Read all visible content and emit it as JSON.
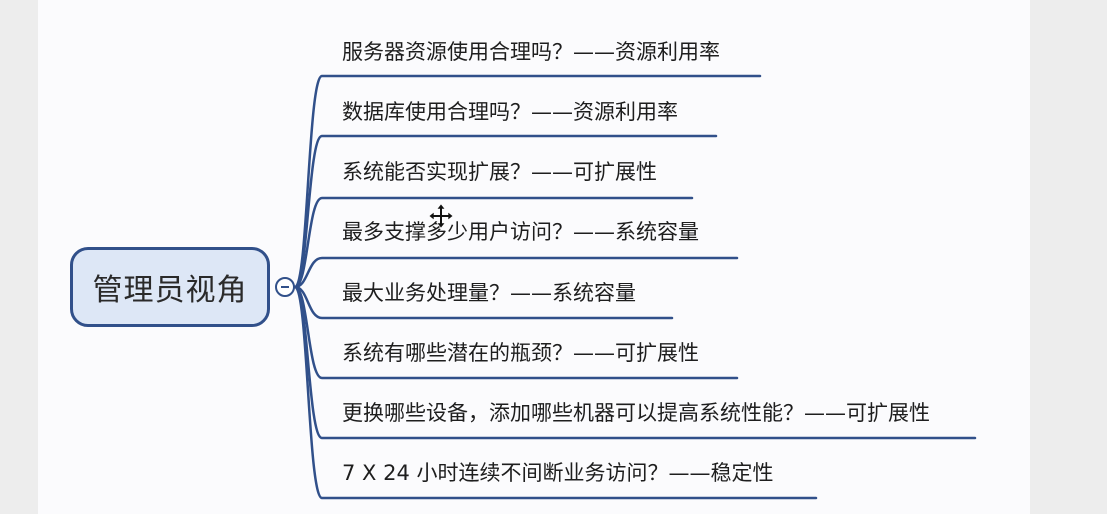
{
  "root": {
    "label": "管理员视角"
  },
  "branches": [
    {
      "label": "服务器资源使用合理吗？——资源利用率"
    },
    {
      "label": "数据库使用合理吗？——资源利用率"
    },
    {
      "label": "系统能否实现扩展？——可扩展性"
    },
    {
      "label": "最多支撑多少用户访问？——系统容量"
    },
    {
      "label": "最大业务处理量？——系统容量"
    },
    {
      "label": "系统有哪些潜在的瓶颈？——可扩展性"
    },
    {
      "label": "更换哪些设备，添加哪些机器可以提高系统性能？——可扩展性"
    },
    {
      "label": "7 X 24 小时连续不间断业务访问？——稳定性"
    }
  ],
  "colors": {
    "line": "#31508a",
    "root_fill": "#dde7f6"
  },
  "icons": {
    "toggle": "collapse-minus-icon",
    "cursor": "move-cursor-icon"
  }
}
